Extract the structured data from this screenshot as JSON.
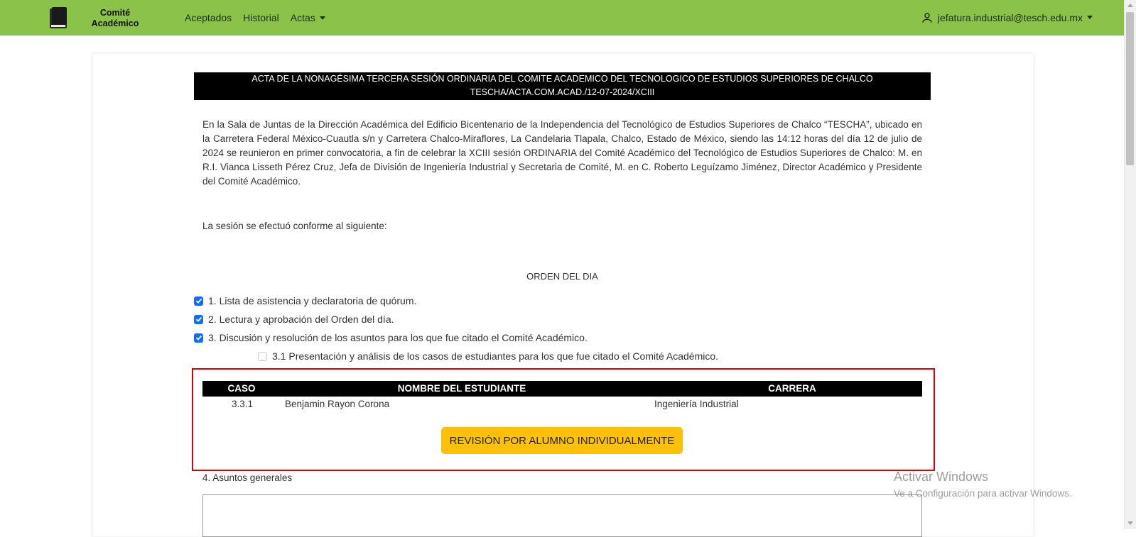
{
  "navbar": {
    "brand_line1": "Comité",
    "brand_line2": "Académico",
    "links": [
      "Aceptados",
      "Historial",
      "Actas"
    ],
    "user_email": "jefatura.industrial@tesch.edu.mx",
    "bg_color": "#8bc34a"
  },
  "acta": {
    "title_line1": "ACTA DE LA NONAGÉSIMA TERCERA SESIÓN ORDINARIA DEL COMITE ACADEMICO DEL TECNOLOGICO DE ESTUDIOS SUPERIORES DE CHALCO",
    "title_line2": "TESCHA/ACTA.COM.ACAD./12-07-2024/XCIII",
    "intro": "En la Sala de Juntas de la Dirección Académica del Edificio Bicentenario de la Independencia del Tecnológico de Estudios Superiores de Chalco “TESCHA”, ubicado en la Carretera Federal México-Cuautla s/n y Carretera Chalco-Miraflores, La Candelaria Tlapala, Chalco, Estado de México, siendo las 14:12 horas del día 12 de julio de 2024 se reunieron en primer convocatoria, a fin de celebrar la XCIII sesión ORDINARIA del Comité Académico del Tecnológico de Estudios Superiores de Chalco: M. en R.I. Vianca Lisseth Pérez Cruz, Jefa de División de Ingeniería Industrial y Secretaria de Comité, M. en C. Roberto Leguízamo Jiménez, Director Académico y Presidente del Comité Académico.",
    "session_text": "La sesión se efectuó conforme al siguiente:",
    "orden_title": "ORDEN DEL DIA",
    "agenda": [
      {
        "label": "1. Lista de asistencia y declaratoria de quórum.",
        "checked": true
      },
      {
        "label": "2. Lectura y aprobación del Orden del día.",
        "checked": true
      },
      {
        "label": "3. Discusión y resolución de los asuntos para los que fue citado el Comité Académico.",
        "checked": true
      },
      {
        "label": "3.1 Presentación y análisis de los casos de estudiantes para los que fue citado el Comité Académico.",
        "checked": false
      }
    ],
    "case_table": {
      "headers": [
        "CASO",
        "NOMBRE DEL ESTUDIANTE",
        "CARRERA"
      ],
      "rows": [
        {
          "caso": "3.3.1",
          "nombre": "Benjamin Rayon Corona",
          "carrera": "Ingeniería Industrial"
        }
      ]
    },
    "review_button": "REVISIÓN POR ALUMNO INDIVIDUALMENTE",
    "asuntos_label": "4. Asuntos generales"
  },
  "watermark": {
    "title": "Activar Windows",
    "subtitle": "Ve a Configuración para activar Windows."
  }
}
